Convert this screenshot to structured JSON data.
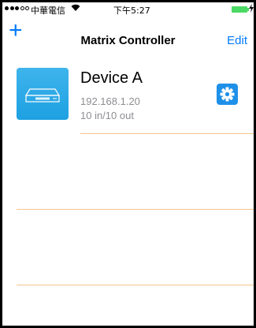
{
  "status_bar": {
    "carrier": "中華電信",
    "wifi_icon": "wifi-icon",
    "time": "下午5:27",
    "battery_color": "#4cd964"
  },
  "nav": {
    "add_label": "+",
    "title": "Matrix Controller",
    "edit_label": "Edit"
  },
  "devices": [
    {
      "name": "Device A",
      "ip": "192.168.1.20",
      "io": "10 in/10 out",
      "settings_icon": "gear-icon"
    }
  ],
  "colors": {
    "accent": "#007aff",
    "device_icon": "#2aa8e7",
    "separator": "#f5c58a",
    "secondary_text": "#8e8e93"
  }
}
